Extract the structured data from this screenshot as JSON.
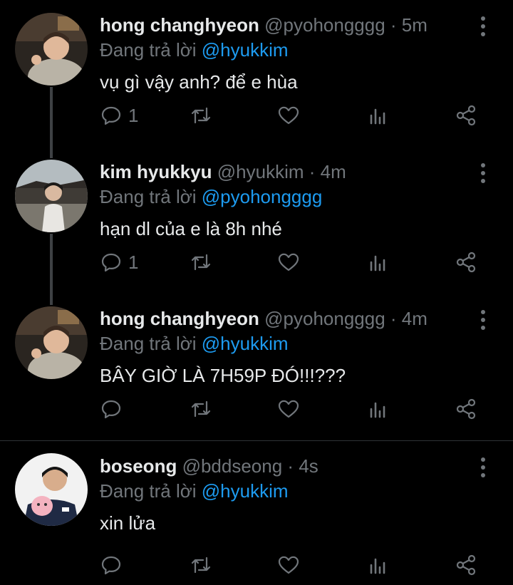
{
  "colors": {
    "background": "#000000",
    "text": "#e7e9ea",
    "muted": "#71767b",
    "accent": "#1d9bf0",
    "thread_line": "#3e4144"
  },
  "tweets": [
    {
      "name": "hong changhyeon",
      "handle": "@pyohongggg",
      "sep": " · ",
      "time": "5m",
      "reply_prefix": "Đang trả lời ",
      "reply_to": "@hyukkim",
      "text": "vụ gì vậy anh? để e hùa",
      "reply_count": "1"
    },
    {
      "name": "kim hyukkyu",
      "handle": "@hyukkim",
      "sep": " · ",
      "time": "4m",
      "reply_prefix": "Đang trả lời ",
      "reply_to": "@pyohongggg",
      "text": "hạn dl của e là 8h nhé",
      "reply_count": "1"
    },
    {
      "name": "hong changhyeon",
      "handle": "@pyohongggg",
      "sep": " · ",
      "time": "4m",
      "reply_prefix": "Đang trả lời ",
      "reply_to": "@hyukkim",
      "text": "BÂY GIỜ LÀ 7H59P ĐÓ!!!???",
      "reply_count": ""
    },
    {
      "name": "boseong",
      "handle": "@bddseong",
      "sep": " · ",
      "time": "4s",
      "reply_prefix": "Đang trả lời ",
      "reply_to": "@hyukkim",
      "text": "xin lửa",
      "reply_count": ""
    }
  ],
  "icons": [
    "reply-icon",
    "retweet-icon",
    "like-icon",
    "analytics-icon",
    "share-icon",
    "more-icon"
  ]
}
